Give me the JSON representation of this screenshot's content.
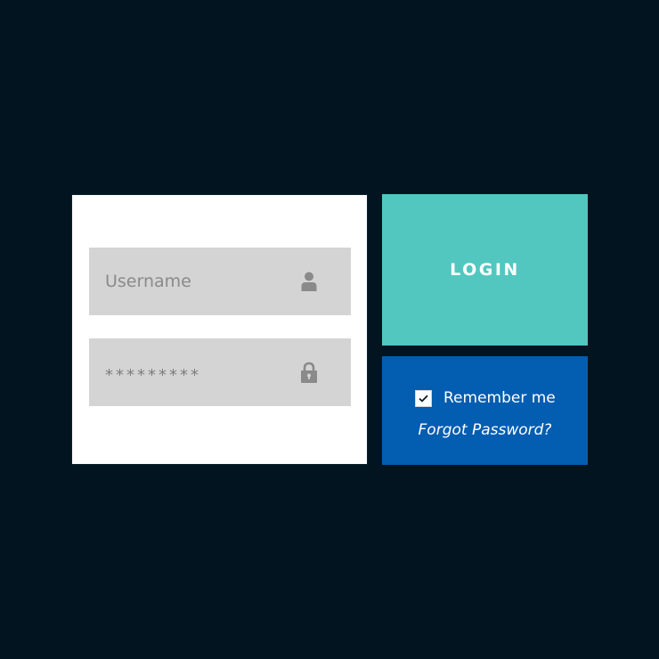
{
  "form": {
    "username_placeholder": "Username",
    "password_value": "*********"
  },
  "login": {
    "label": "LOGIN"
  },
  "options": {
    "remember_label": "Remember me",
    "remember_checked": "true",
    "forgot_label": "Forgot Password?"
  },
  "icons": {
    "username": "user-icon",
    "password": "lock-icon",
    "checkbox": "checkmark-icon"
  },
  "colors": {
    "background": "#01141f",
    "form_panel": "#ffffff",
    "field": "#d4d4d4",
    "login_tile": "#51c7c0",
    "options_tile": "#035db1"
  }
}
